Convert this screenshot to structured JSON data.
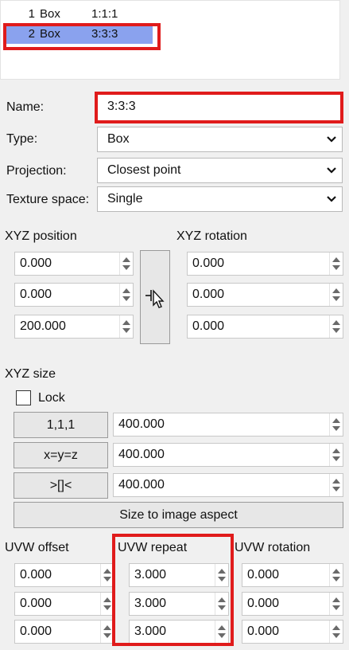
{
  "list": {
    "items": [
      {
        "index": "1",
        "type": "Box",
        "name": "1:1:1",
        "selected": false
      },
      {
        "index": "2",
        "type": "Box",
        "name": "3:3:3",
        "selected": true
      }
    ]
  },
  "form": {
    "name_label": "Name:",
    "name_value": "3:3:3",
    "type_label": "Type:",
    "type_value": "Box",
    "projection_label": "Projection:",
    "projection_value": "Closest point",
    "texture_space_label": "Texture space:",
    "texture_space_value": "Single"
  },
  "xyz_position": {
    "label": "XYZ position",
    "values": [
      "0.000",
      "0.000",
      "200.000"
    ]
  },
  "xyz_rotation": {
    "label": "XYZ rotation",
    "values": [
      "0.000",
      "0.000",
      "0.000"
    ]
  },
  "xyz_size": {
    "label": "XYZ size",
    "lock_label": "Lock",
    "lock_checked": false,
    "buttons": [
      "1,1,1",
      "x=y=z",
      ">[]<"
    ],
    "values": [
      "400.000",
      "400.000",
      "400.000"
    ],
    "aspect_button": "Size to image aspect"
  },
  "uvw_offset": {
    "label": "UVW offset",
    "values": [
      "0.000",
      "0.000",
      "0.000"
    ]
  },
  "uvw_repeat": {
    "label": "UVW repeat",
    "values": [
      "3.000",
      "3.000",
      "3.000"
    ]
  },
  "uvw_rotation": {
    "label": "UVW rotation",
    "values": [
      "0.000",
      "0.000",
      "0.000"
    ]
  },
  "icons": {
    "picker": "pick-cursor-icon",
    "combo_arrow": "chevron-down-icon"
  },
  "colors": {
    "selection": "#8aa2ee",
    "highlight": "#e01b1b"
  }
}
